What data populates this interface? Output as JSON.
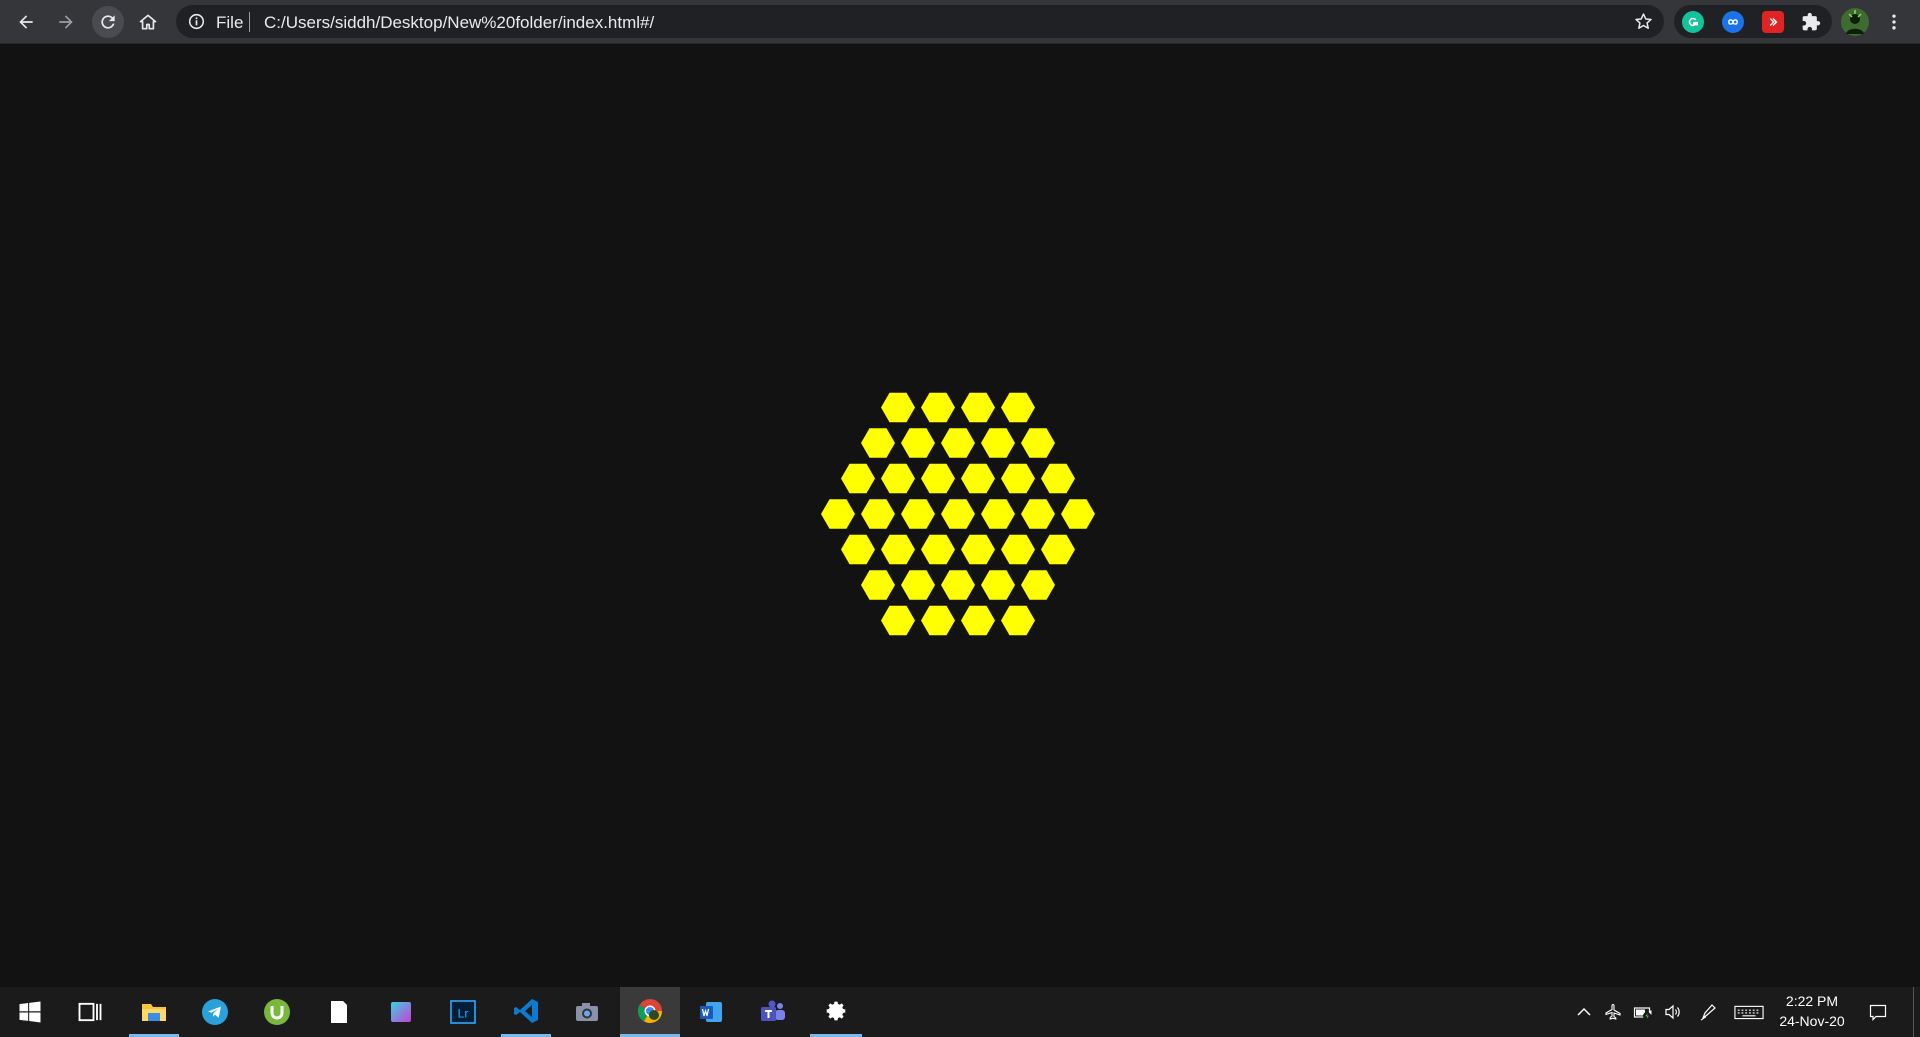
{
  "browser": {
    "scheme_label": "File",
    "url": "C:/Users/siddh/Desktop/New%20folder/index.html#/"
  },
  "content": {
    "shape": "hexagon",
    "fill_color": "#ffff00",
    "background_color": "#121212",
    "row_counts": [
      4,
      5,
      6,
      7,
      6,
      5,
      4
    ]
  },
  "taskbar": {
    "apps": [
      "start",
      "task-view",
      "file-explorer",
      "telegram",
      "utorrent",
      "notepad",
      "app-square",
      "lightroom",
      "vscode",
      "camera",
      "chrome",
      "word",
      "teams",
      "settings"
    ],
    "lightroom_label": "Lr",
    "time": "2:22 PM",
    "date": "24-Nov-20"
  }
}
